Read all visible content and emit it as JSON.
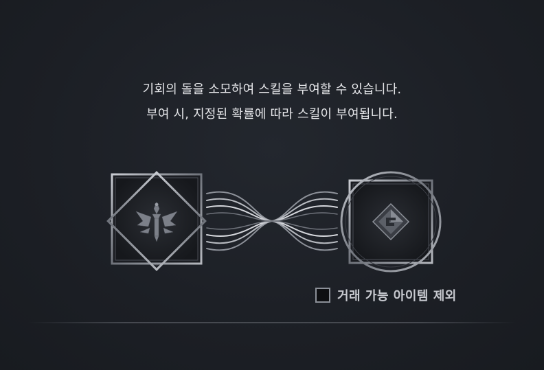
{
  "description": {
    "line1": "기회의 돌을 소모하여 스킬을 부여할 수 있습니다.",
    "line2": "부여 시, 지정된 확률에 따라 스킬이 부여됩니다."
  },
  "slots": {
    "left_icon": "skill-emblem-icon",
    "right_icon": "stone-icon",
    "link_icon": "infinity-link-icon"
  },
  "filter": {
    "checked": false,
    "label": "거래 가능 아이템 제외"
  }
}
